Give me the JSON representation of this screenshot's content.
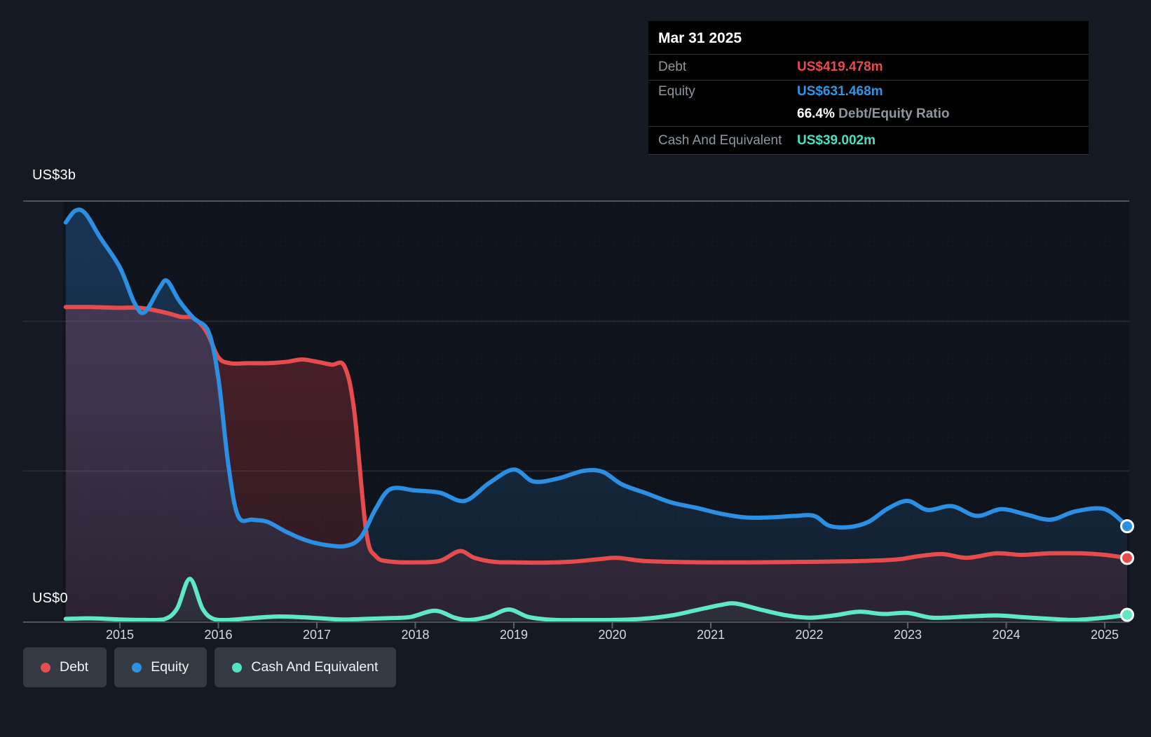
{
  "tooltip": {
    "date": "Mar 31 2025",
    "debt_label": "Debt",
    "debt_value": "US$419.478m",
    "equity_label": "Equity",
    "equity_value": "US$631.468m",
    "ratio_value": "66.4%",
    "ratio_label": "Debt/Equity Ratio",
    "cash_label": "Cash And Equivalent",
    "cash_value": "US$39.002m"
  },
  "y_axis": {
    "top_label": "US$3b",
    "bottom_label": "US$0"
  },
  "x_axis": {
    "years": [
      "2015",
      "2016",
      "2017",
      "2018",
      "2019",
      "2020",
      "2021",
      "2022",
      "2023",
      "2024",
      "2025"
    ]
  },
  "legend": [
    {
      "label": "Debt",
      "color": "#e4504e"
    },
    {
      "label": "Equity",
      "color": "#2e90e0"
    },
    {
      "label": "Cash And Equivalent",
      "color": "#55e2c2"
    }
  ],
  "colors": {
    "debt_line": "#e64c4c",
    "equity_line": "#2b90e3",
    "cash_line": "#5ee8c6",
    "page_bg": "#141923",
    "plot_bg": "#0f141c",
    "grid_faint": "#262b33",
    "grid_strong": "#4d535c"
  },
  "chart_data": {
    "type": "area",
    "unit": "US$ billions",
    "ylim": [
      0,
      3
    ],
    "y_gridline_values": [
      0,
      1,
      2,
      3
    ],
    "x_range": [
      2014.45,
      2025.25
    ],
    "end_date": "Mar 31 2025",
    "end_values_m": {
      "debt": 419.478,
      "equity": 631.468,
      "cash": 39.002
    },
    "series": [
      {
        "name": "Equity",
        "color": "#2b90e3",
        "points": [
          [
            2014.45,
            2.66
          ],
          [
            2014.55,
            2.74
          ],
          [
            2014.65,
            2.72
          ],
          [
            2014.8,
            2.56
          ],
          [
            2015.0,
            2.36
          ],
          [
            2015.15,
            2.12
          ],
          [
            2015.25,
            2.06
          ],
          [
            2015.4,
            2.22
          ],
          [
            2015.48,
            2.27
          ],
          [
            2015.6,
            2.14
          ],
          [
            2015.75,
            2.02
          ],
          [
            2015.9,
            1.93
          ],
          [
            2016.0,
            1.62
          ],
          [
            2016.1,
            1.05
          ],
          [
            2016.2,
            0.7
          ],
          [
            2016.35,
            0.675
          ],
          [
            2016.5,
            0.66
          ],
          [
            2016.7,
            0.59
          ],
          [
            2016.9,
            0.535
          ],
          [
            2017.1,
            0.505
          ],
          [
            2017.3,
            0.5
          ],
          [
            2017.45,
            0.56
          ],
          [
            2017.6,
            0.75
          ],
          [
            2017.75,
            0.88
          ],
          [
            2018.0,
            0.87
          ],
          [
            2018.25,
            0.855
          ],
          [
            2018.5,
            0.8
          ],
          [
            2018.75,
            0.92
          ],
          [
            2019.0,
            1.01
          ],
          [
            2019.2,
            0.93
          ],
          [
            2019.45,
            0.95
          ],
          [
            2019.7,
            1.0
          ],
          [
            2019.9,
            0.995
          ],
          [
            2020.1,
            0.91
          ],
          [
            2020.35,
            0.85
          ],
          [
            2020.6,
            0.79
          ],
          [
            2020.85,
            0.755
          ],
          [
            2021.1,
            0.715
          ],
          [
            2021.35,
            0.69
          ],
          [
            2021.6,
            0.69
          ],
          [
            2021.85,
            0.7
          ],
          [
            2022.05,
            0.7
          ],
          [
            2022.2,
            0.635
          ],
          [
            2022.4,
            0.625
          ],
          [
            2022.6,
            0.66
          ],
          [
            2022.8,
            0.75
          ],
          [
            2023.0,
            0.8
          ],
          [
            2023.2,
            0.74
          ],
          [
            2023.45,
            0.765
          ],
          [
            2023.7,
            0.7
          ],
          [
            2023.95,
            0.745
          ],
          [
            2024.2,
            0.71
          ],
          [
            2024.45,
            0.675
          ],
          [
            2024.7,
            0.73
          ],
          [
            2025.0,
            0.745
          ],
          [
            2025.25,
            0.631
          ]
        ]
      },
      {
        "name": "Debt",
        "color": "#e64c4c",
        "points": [
          [
            2014.45,
            2.095
          ],
          [
            2014.7,
            2.095
          ],
          [
            2015.0,
            2.09
          ],
          [
            2015.2,
            2.09
          ],
          [
            2015.45,
            2.06
          ],
          [
            2015.62,
            2.03
          ],
          [
            2015.75,
            2.02
          ],
          [
            2015.88,
            1.93
          ],
          [
            2016.0,
            1.76
          ],
          [
            2016.12,
            1.72
          ],
          [
            2016.3,
            1.72
          ],
          [
            2016.5,
            1.72
          ],
          [
            2016.7,
            1.73
          ],
          [
            2016.85,
            1.745
          ],
          [
            2017.0,
            1.73
          ],
          [
            2017.15,
            1.71
          ],
          [
            2017.28,
            1.7
          ],
          [
            2017.38,
            1.4
          ],
          [
            2017.5,
            0.6
          ],
          [
            2017.6,
            0.43
          ],
          [
            2017.75,
            0.395
          ],
          [
            2018.0,
            0.39
          ],
          [
            2018.25,
            0.4
          ],
          [
            2018.45,
            0.465
          ],
          [
            2018.6,
            0.42
          ],
          [
            2018.8,
            0.393
          ],
          [
            2019.0,
            0.39
          ],
          [
            2019.3,
            0.388
          ],
          [
            2019.6,
            0.395
          ],
          [
            2019.85,
            0.41
          ],
          [
            2020.05,
            0.42
          ],
          [
            2020.3,
            0.4
          ],
          [
            2020.6,
            0.393
          ],
          [
            2021.0,
            0.39
          ],
          [
            2021.4,
            0.39
          ],
          [
            2021.8,
            0.392
          ],
          [
            2022.2,
            0.395
          ],
          [
            2022.6,
            0.4
          ],
          [
            2022.9,
            0.41
          ],
          [
            2023.1,
            0.43
          ],
          [
            2023.35,
            0.445
          ],
          [
            2023.6,
            0.42
          ],
          [
            2023.9,
            0.45
          ],
          [
            2024.15,
            0.44
          ],
          [
            2024.45,
            0.45
          ],
          [
            2024.75,
            0.45
          ],
          [
            2025.0,
            0.44
          ],
          [
            2025.25,
            0.419
          ]
        ]
      },
      {
        "name": "Cash And Equivalent",
        "color": "#5ee8c6",
        "points": [
          [
            2014.45,
            0.012
          ],
          [
            2014.7,
            0.016
          ],
          [
            2015.0,
            0.008
          ],
          [
            2015.25,
            0.005
          ],
          [
            2015.45,
            0.01
          ],
          [
            2015.58,
            0.08
          ],
          [
            2015.71,
            0.28
          ],
          [
            2015.84,
            0.08
          ],
          [
            2015.95,
            0.012
          ],
          [
            2016.1,
            0.005
          ],
          [
            2016.35,
            0.018
          ],
          [
            2016.6,
            0.028
          ],
          [
            2016.8,
            0.025
          ],
          [
            2017.0,
            0.018
          ],
          [
            2017.25,
            0.008
          ],
          [
            2017.5,
            0.012
          ],
          [
            2017.75,
            0.018
          ],
          [
            2017.95,
            0.025
          ],
          [
            2018.2,
            0.067
          ],
          [
            2018.4,
            0.02
          ],
          [
            2018.55,
            0.005
          ],
          [
            2018.75,
            0.028
          ],
          [
            2018.95,
            0.075
          ],
          [
            2019.15,
            0.025
          ],
          [
            2019.4,
            0.006
          ],
          [
            2019.7,
            0.004
          ],
          [
            2020.0,
            0.005
          ],
          [
            2020.3,
            0.012
          ],
          [
            2020.6,
            0.035
          ],
          [
            2020.85,
            0.07
          ],
          [
            2021.1,
            0.105
          ],
          [
            2021.25,
            0.115
          ],
          [
            2021.5,
            0.075
          ],
          [
            2021.75,
            0.038
          ],
          [
            2022.0,
            0.02
          ],
          [
            2022.25,
            0.035
          ],
          [
            2022.5,
            0.06
          ],
          [
            2022.75,
            0.045
          ],
          [
            2023.0,
            0.052
          ],
          [
            2023.25,
            0.02
          ],
          [
            2023.6,
            0.028
          ],
          [
            2023.9,
            0.035
          ],
          [
            2024.15,
            0.025
          ],
          [
            2024.45,
            0.012
          ],
          [
            2024.7,
            0.005
          ],
          [
            2025.0,
            0.02
          ],
          [
            2025.25,
            0.039
          ]
        ]
      }
    ]
  }
}
